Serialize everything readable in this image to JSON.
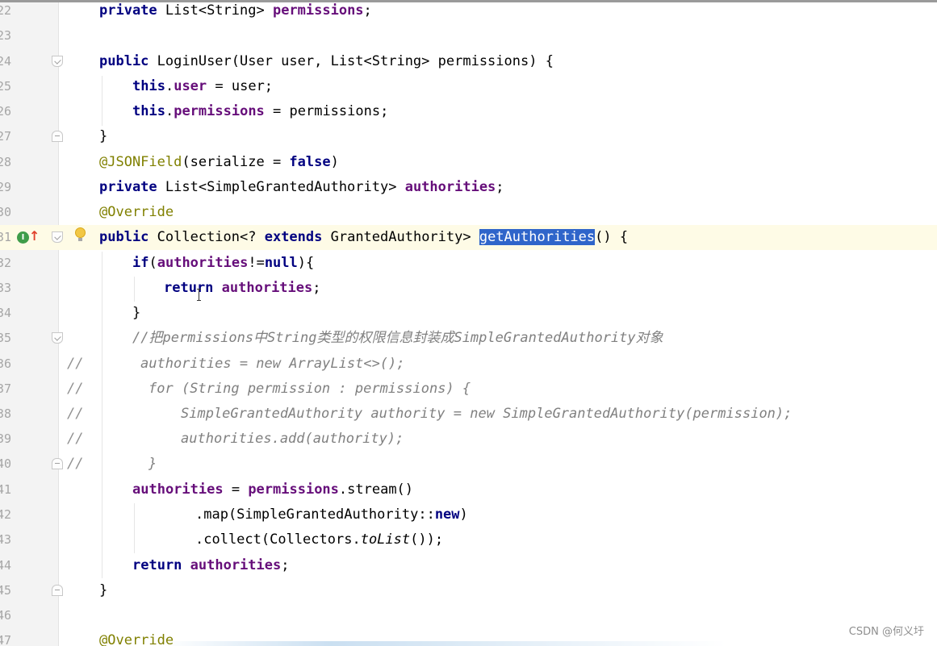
{
  "editor": {
    "line_numbers": [
      "22",
      "23",
      "24",
      "25",
      "26",
      "27",
      "28",
      "29",
      "30",
      "31",
      "32",
      "33",
      "34",
      "35",
      "36",
      "37",
      "38",
      "39",
      "40",
      "41",
      "42",
      "43",
      "44",
      "45",
      "46",
      "47"
    ],
    "comment_marker": "//",
    "code": {
      "l22": {
        "a": "private ",
        "b": "List<String> ",
        "c": "permissions",
        "d": ";"
      },
      "l24": {
        "a": "public ",
        "b": "LoginUser(User user, List<String> permissions) {"
      },
      "l25": {
        "a": "this",
        "b": ".",
        "c": "user",
        "d": " = user;"
      },
      "l26": {
        "a": "this",
        "b": ".",
        "c": "permissions",
        "d": " = permissions;"
      },
      "l27": {
        "a": "}"
      },
      "l28": {
        "a": "@JSONField",
        "b": "(serialize = ",
        "c": "false",
        "d": ")"
      },
      "l29": {
        "a": "private ",
        "b": "List<SimpleGrantedAuthority> ",
        "c": "authorities",
        "d": ";"
      },
      "l30": {
        "a": "@Override"
      },
      "l31": {
        "a": "public ",
        "b": "Collection<? ",
        "c": "extends ",
        "d": "GrantedAuthority> ",
        "e": "getAuthorities",
        "f": "() {"
      },
      "l32": {
        "a": "if",
        "b": "(",
        "c": "authorities",
        "d": "!=",
        "e": "null",
        "f": "){"
      },
      "l33": {
        "a": "return ",
        "b": "authorities",
        "c": ";"
      },
      "l34": {
        "a": "}"
      },
      "l35": {
        "a": "//把permissions中String类型的权限信息封装成SimpleGrantedAuthority对象"
      },
      "l36": {
        "a": "authorities = new ArrayList<>();"
      },
      "l37": {
        "a": "for (String permission : permissions) {"
      },
      "l38": {
        "a": "SimpleGrantedAuthority authority = new SimpleGrantedAuthority(permission);"
      },
      "l39": {
        "a": "authorities.add(authority);"
      },
      "l40": {
        "a": "}"
      },
      "l41": {
        "a": "authorities",
        "b": " = ",
        "c": "permissions",
        "d": ".stream()"
      },
      "l42": {
        "a": ".map(SimpleGrantedAuthority::",
        "b": "new",
        "c": ")"
      },
      "l43": {
        "a": ".collect(Collectors.",
        "b": "toList",
        "c": "());"
      },
      "l44": {
        "a": "return ",
        "b": "authorities",
        "c": ";"
      },
      "l45": {
        "a": "}"
      },
      "l47": {
        "a": "@Override"
      }
    }
  },
  "gutter_icons": {
    "implements": "I",
    "implements_icon": "implements-method-icon",
    "override_arrow": "↑",
    "override_icon": "override-arrow-icon",
    "bulb_icon": "lightbulb-icon"
  },
  "watermark": "CSDN @何义圩",
  "colors": {
    "keyword": "#000080",
    "field": "#660e7a",
    "annotation": "#808000",
    "comment": "#808080",
    "selection": "#2f65ca",
    "caret_line": "#fefbe6"
  }
}
